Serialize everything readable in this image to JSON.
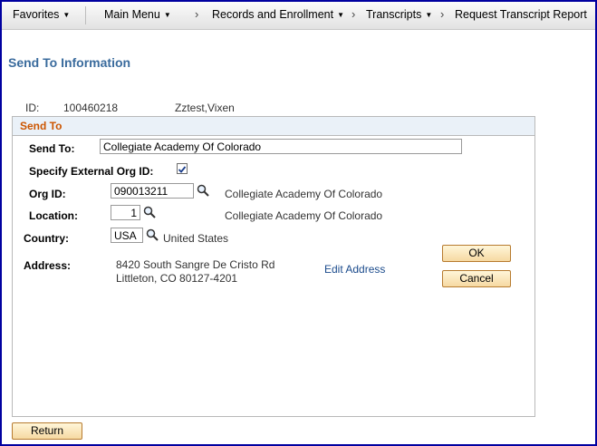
{
  "nav": {
    "favorites": "Favorites",
    "main_menu": "Main Menu",
    "breadcrumbs": [
      "Records and Enrollment",
      "Transcripts",
      "Request Transcript Report"
    ],
    "separator": "›"
  },
  "page": {
    "title": "Send To Information"
  },
  "student": {
    "id_label": "ID:",
    "id": "100460218",
    "name": "Zztest,Vixen"
  },
  "send_to_group": {
    "title": "Send To",
    "send_to_label": "Send To:",
    "send_to_value": "Collegiate Academy Of Colorado",
    "ext_org_label": "Specify External Org ID:",
    "ext_org_checked": true,
    "org_id_label": "Org ID:",
    "org_id_value": "090013211",
    "org_desc": "Collegiate Academy Of Colorado",
    "location_label": "Location:",
    "location_value": "1",
    "location_desc": "Collegiate Academy Of Colorado",
    "country_label": "Country:",
    "country_value": "USA",
    "country_desc": "United States",
    "address_label": "Address:",
    "address_line1": "8420 South Sangre De Cristo Rd",
    "address_line2": "Littleton, CO 80127-4201",
    "edit_address": "Edit Address",
    "ok": "OK",
    "cancel": "Cancel"
  },
  "return_label": "Return",
  "colors": {
    "title": "#3a6b9d",
    "group_title": "#cc5500",
    "link": "#1b4b8c",
    "button_bg": "#f6d9a2",
    "frame": "#0000a0"
  }
}
